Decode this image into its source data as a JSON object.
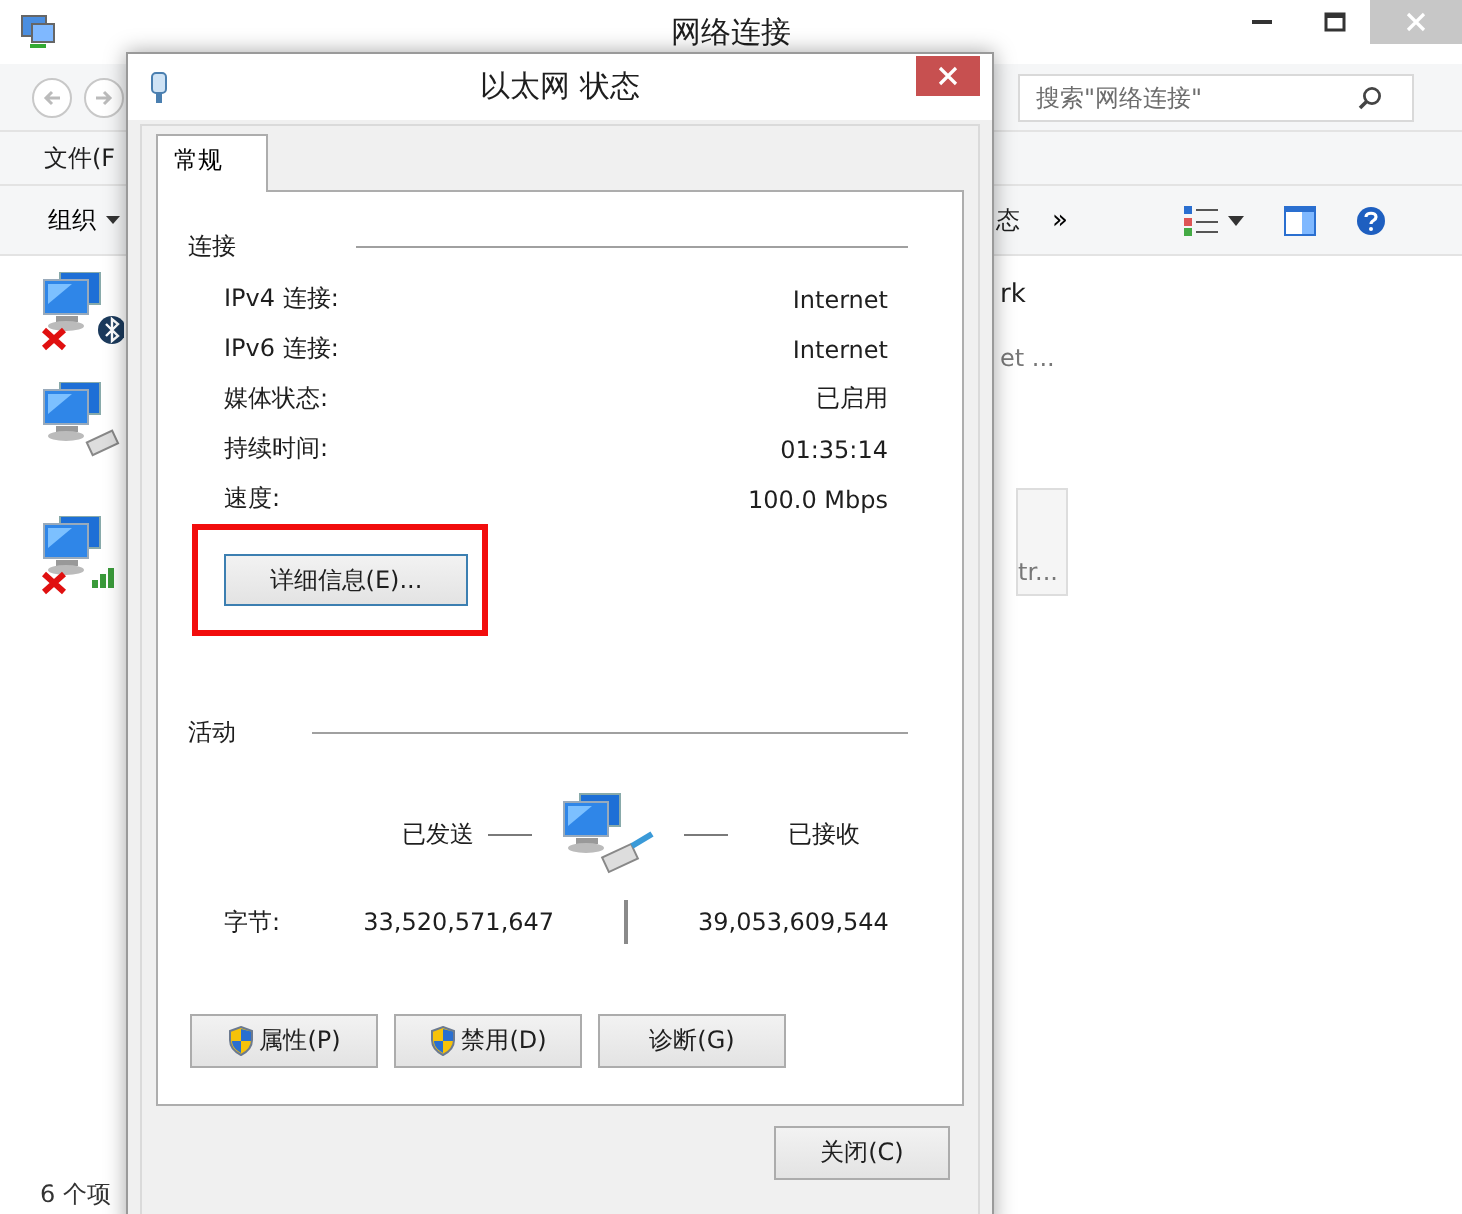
{
  "explorer": {
    "title": "网络连接",
    "search": {
      "placeholder": "搜索\"网络连接\""
    },
    "menu": [
      "文件(F"
    ],
    "toolbar": {
      "organize": "组织",
      "partial": "态",
      "more": "»"
    },
    "adapters": [
      {
        "kind": "bluetooth",
        "disabled": true
      },
      {
        "kind": "wired",
        "disabled": false
      },
      {
        "kind": "wireless",
        "disabled": true
      }
    ],
    "item_texts": [
      "rk",
      "et ..."
    ],
    "tile_text": "tr...",
    "status": "6 个项"
  },
  "dialog": {
    "title": "以太网 状态",
    "tabs": [
      {
        "label": "常规",
        "selected": true
      }
    ],
    "connection": {
      "heading": "连接",
      "rows": [
        {
          "label": "IPv4 连接:",
          "value": "Internet"
        },
        {
          "label": "IPv6 连接:",
          "value": "Internet"
        },
        {
          "label": "媒体状态:",
          "value": "已启用"
        },
        {
          "label": "持续时间:",
          "value": "01:35:14"
        },
        {
          "label": "速度:",
          "value": "100.0 Mbps"
        }
      ]
    },
    "details_button": {
      "label": "详细信息(E)...",
      "highlighted": true
    },
    "activity": {
      "heading": "活动",
      "sent_label": "已发送",
      "received_label": "已接收",
      "bytes_label": "字节:",
      "sent": "33,520,571,647",
      "received": "39,053,609,544"
    },
    "buttons": [
      {
        "label": "属性(P)",
        "shield": true
      },
      {
        "label": "禁用(D)",
        "shield": true
      },
      {
        "label": "诊断(G)",
        "shield": false
      }
    ],
    "close_button": "关闭(C)"
  }
}
